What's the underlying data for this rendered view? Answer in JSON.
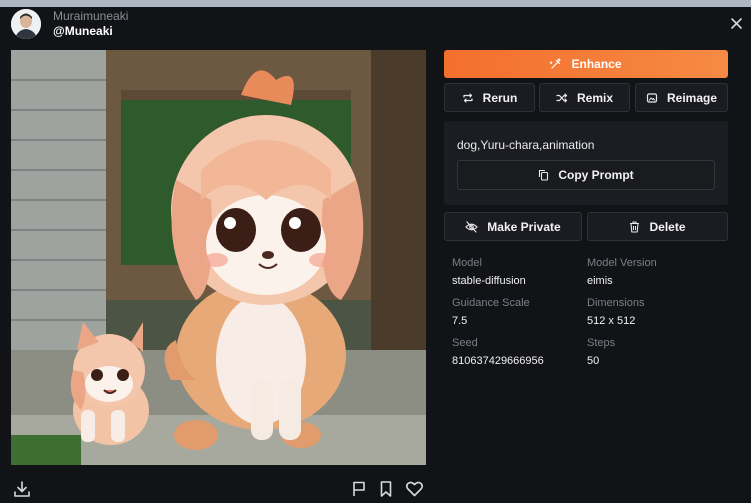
{
  "header": {
    "user_name": "Muraimuneaki",
    "user_handle": "@Muneaki"
  },
  "actions": {
    "enhance": "Enhance",
    "rerun": "Rerun",
    "remix": "Remix",
    "reimage": "Reimage",
    "copy_prompt": "Copy Prompt",
    "make_private": "Make Private",
    "delete": "Delete"
  },
  "prompt": {
    "text": "dog,Yuru-chara,animation"
  },
  "details": {
    "model_label": "Model",
    "model_value": "stable-diffusion",
    "model_version_label": "Model Version",
    "model_version_value": "eimis",
    "guidance_label": "Guidance Scale",
    "guidance_value": "7.5",
    "dimensions_label": "Dimensions",
    "dimensions_value": "512 x 512",
    "seed_label": "Seed",
    "seed_value": "810637429666956",
    "steps_label": "Steps",
    "steps_value": "50"
  },
  "icons": {
    "close": "close-icon",
    "download": "download-icon",
    "flag": "flag-icon",
    "bookmark": "bookmark-icon",
    "heart": "heart-icon",
    "enhance": "sparkle-wand-icon",
    "rerun": "repeat-icon",
    "remix": "shuffle-icon",
    "reimage": "image-icon",
    "copy": "copy-icon",
    "private": "eye-off-icon",
    "delete": "trash-icon"
  },
  "colors": {
    "accent": "#f47a36",
    "panel": "#121317",
    "button": "#1b1c21"
  }
}
